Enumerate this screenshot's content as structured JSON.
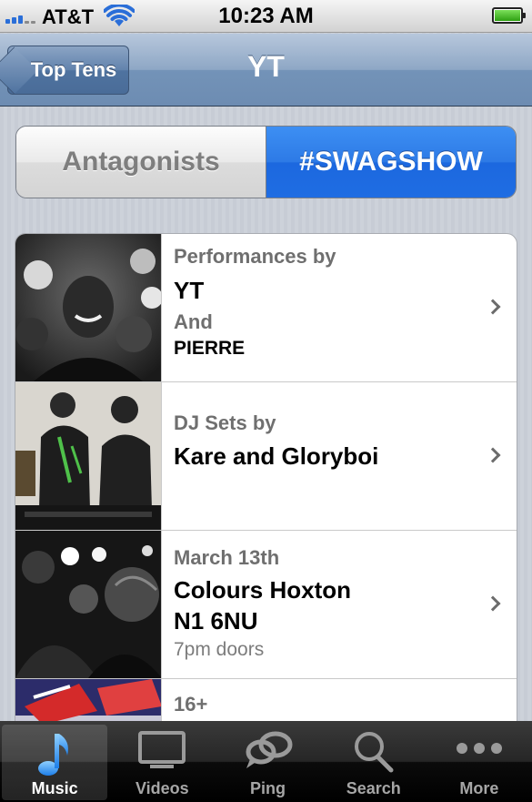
{
  "status_bar": {
    "carrier": "AT&T",
    "time": "10:23 AM",
    "icons": [
      "signal-icon",
      "wifi-icon",
      "battery-icon"
    ]
  },
  "nav": {
    "back_label": "Top Tens",
    "title": "YT"
  },
  "segmented": {
    "options": [
      "Antagonists",
      "#SWAGSHOW"
    ],
    "selected": "#SWAGSHOW"
  },
  "list": {
    "items": [
      {
        "lines": [
          "Performances by",
          "YT",
          "And",
          "PIERRE"
        ],
        "image": "crowd-photo-smiling"
      },
      {
        "lines": [
          "DJ Sets by",
          "Kare and Gloryboi"
        ],
        "image": "dj-booth-photo"
      },
      {
        "lines": [
          "March 13th",
          "Colours Hoxton",
          "N1 6NU",
          "7pm doors"
        ],
        "image": "party-crowd-photo"
      },
      {
        "lines": [
          "16+"
        ],
        "image": "red-flag-photo"
      }
    ]
  },
  "tab_bar": {
    "tabs": [
      {
        "label": "Music",
        "icon": "music-note-icon"
      },
      {
        "label": "Videos",
        "icon": "tv-icon"
      },
      {
        "label": "Ping",
        "icon": "ping-icon"
      },
      {
        "label": "Search",
        "icon": "search-icon"
      },
      {
        "label": "More",
        "icon": "more-icon"
      }
    ],
    "active": "Music"
  },
  "colors": {
    "accent_blue": "#2d7ae6",
    "nav_blue": "#7393b8",
    "tab_active_icon": "#3b9cf0"
  }
}
